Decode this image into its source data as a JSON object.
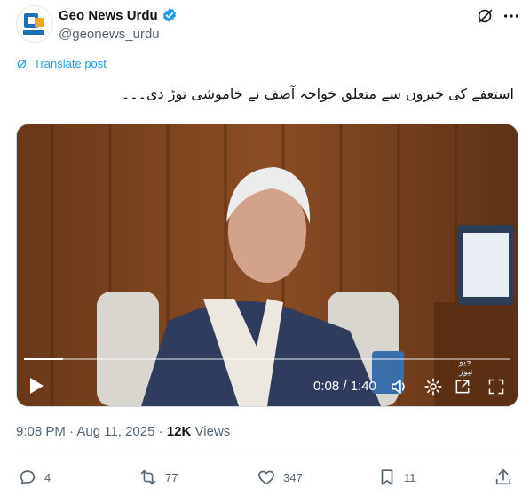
{
  "account": {
    "display_name": "Geo News Urdu",
    "handle": "@geonews_urdu",
    "verified": true,
    "verified_color": "#1d9bf0"
  },
  "header_icons": [
    "grok-icon",
    "more-icon"
  ],
  "translate": {
    "label": "Translate post",
    "color": "#1d9bf0",
    "icon": "translate-icon"
  },
  "tweet": {
    "text": "استعفے کی خبروں سے متعلق خواجہ آصف نے خاموشی توڑ دی۔۔۔"
  },
  "video": {
    "time_display": "0:08 / 1:40",
    "progress": 0.08,
    "icons": [
      "play-icon",
      "volume-icon",
      "settings-icon",
      "popout-icon",
      "fullscreen-icon"
    ],
    "watermark": "جیو نیوز"
  },
  "meta": {
    "timestamp": "9:08 PM · Aug 11, 2025",
    "separator": "·",
    "views_count": "12K",
    "views_label": "Views"
  },
  "actions": {
    "replies": "4",
    "reposts": "77",
    "likes": "347",
    "bookmarks": "11"
  }
}
